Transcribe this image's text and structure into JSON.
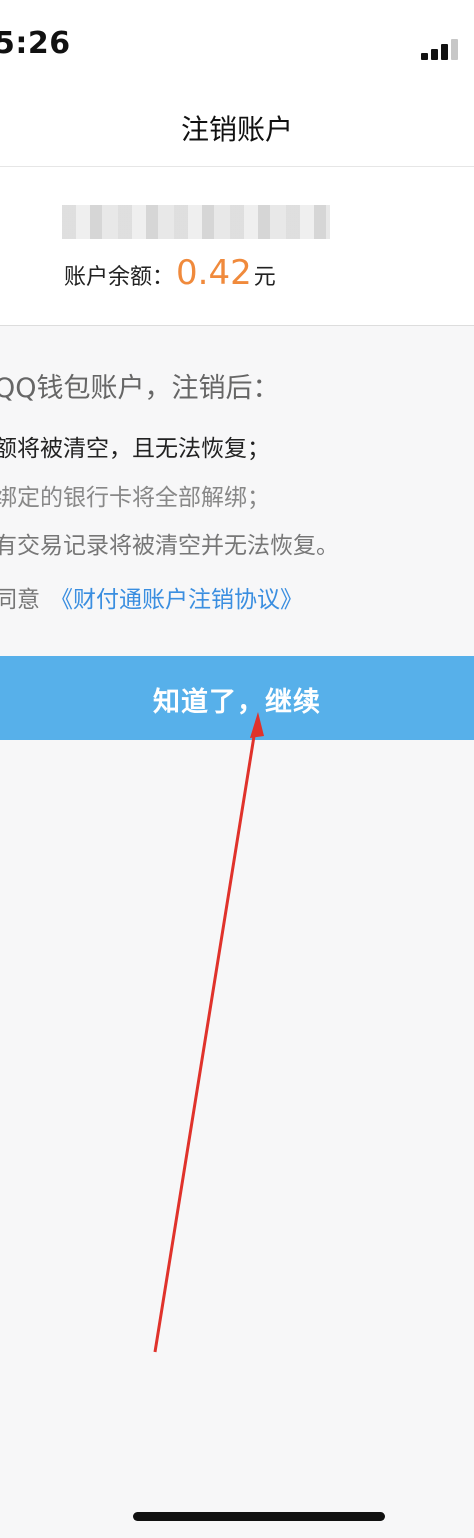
{
  "status_bar": {
    "time": "5:26",
    "signal_icon": "cellular-signal-icon"
  },
  "header": {
    "title": "注销账户"
  },
  "account": {
    "name_blurred": true,
    "balance_label": "账户余额：",
    "balance_value": "0.42",
    "balance_unit": "元"
  },
  "notice": {
    "heading": "QQ钱包账户，注销后：",
    "items": [
      "额将被清空，且无法恢复；",
      "绑定的银行卡将全部解绑；",
      "有交易记录将被清空并无法恢复。"
    ],
    "agree_prefix": "同意",
    "agreement_link": "《财付通账户注销协议》"
  },
  "actions": {
    "continue_label": "知道了，继续"
  },
  "colors": {
    "accent_blue": "#57b0ea",
    "link_blue": "#3a8ee0",
    "balance_orange": "#f08a3c",
    "annotation_red": "#e0322b"
  }
}
